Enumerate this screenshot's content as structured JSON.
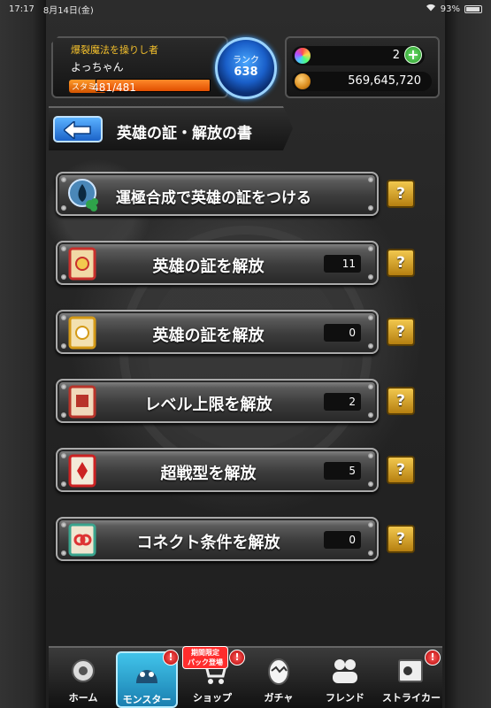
{
  "status_bar": {
    "time": "17:17",
    "date": "8月14日(金)",
    "battery": "93%"
  },
  "player": {
    "title": "爆裂魔法を操りし者",
    "name": "よっちゃん",
    "stamina_label": "スタミナ",
    "stamina_value": "481/481",
    "stamina_fraction": 1.0,
    "rank_label": "ランク",
    "rank_value": "638"
  },
  "currency": {
    "gems": "2",
    "gold": "569,645,720"
  },
  "page": {
    "title": "英雄の証・解放の書"
  },
  "menu": [
    {
      "label": "運極合成で英雄の証をつける",
      "count": null,
      "icon": "clover-seal-icon"
    },
    {
      "label": "英雄の証を解放",
      "count": "11",
      "icon": "red-scroll-icon"
    },
    {
      "label": "英雄の証を解放",
      "count": "0",
      "icon": "gold-scroll-icon"
    },
    {
      "label": "レベル上限を解放",
      "count": "2",
      "icon": "level-scroll-icon"
    },
    {
      "label": "超戦型を解放",
      "count": "5",
      "icon": "super-battle-scroll-icon"
    },
    {
      "label": "コネクト条件を解放",
      "count": "0",
      "icon": "connect-scroll-icon"
    }
  ],
  "help_label": "?",
  "nav": [
    {
      "label": "ホーム",
      "icon": "home-icon",
      "badge": null
    },
    {
      "label": "モンスター",
      "icon": "monster-icon",
      "badge": "!"
    },
    {
      "label": "ショップ",
      "icon": "cart-icon",
      "badge": "!"
    },
    {
      "label": "ガチャ",
      "icon": "egg-icon",
      "badge": null
    },
    {
      "label": "フレンド",
      "icon": "friends-icon",
      "badge": null
    },
    {
      "label": "ストライカー",
      "icon": "striker-card-icon",
      "badge": "!"
    }
  ],
  "promo": {
    "line1": "期間限定",
    "line2": "パック登場"
  },
  "colors": {
    "accent_blue": "#1c63c9",
    "gold": "#f2c84e",
    "stamina": "#e04e00"
  }
}
